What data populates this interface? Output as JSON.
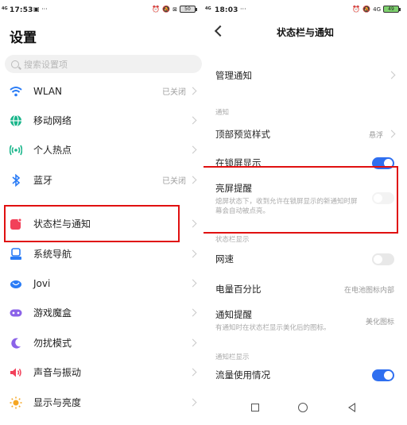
{
  "left": {
    "status": {
      "time": "17:53",
      "battery": "50"
    },
    "title": "设置",
    "search_placeholder": "搜索设置项",
    "items": [
      {
        "label": "WLAN",
        "value": "已关闭",
        "icon": "wifi-icon",
        "color": "#2a7cf6"
      },
      {
        "label": "移动网络",
        "value": "",
        "icon": "globe-icon",
        "color": "#18b58a"
      },
      {
        "label": "个人热点",
        "value": "",
        "icon": "hotspot-icon",
        "color": "#18b58a"
      },
      {
        "label": "蓝牙",
        "value": "已关闭",
        "icon": "bluetooth-icon",
        "color": "#2a7cf6"
      },
      {
        "label": "状态栏与通知",
        "value": "",
        "icon": "notification-icon",
        "color": "#f2415a"
      },
      {
        "label": "系统导航",
        "value": "",
        "icon": "navigation-icon",
        "color": "#2a7cf6"
      },
      {
        "label": "Jovi",
        "value": "",
        "icon": "jovi-icon",
        "color": "#2a7cf6"
      },
      {
        "label": "游戏魔盒",
        "value": "",
        "icon": "gamepad-icon",
        "color": "#8b63e8"
      },
      {
        "label": "勿扰模式",
        "value": "",
        "icon": "moon-icon",
        "color": "#8b63e8"
      },
      {
        "label": "声音与振动",
        "value": "",
        "icon": "speaker-icon",
        "color": "#f2415a"
      },
      {
        "label": "显示与亮度",
        "value": "",
        "icon": "sun-icon",
        "color": "#f5a623"
      }
    ]
  },
  "right": {
    "status": {
      "time": "18:03",
      "battery": "49"
    },
    "title": "状态栏与通知",
    "manage": "管理通知",
    "section_notify": "通知",
    "top_preview": {
      "label": "顶部预览样式",
      "value": "悬浮"
    },
    "lockscreen": {
      "label": "在锁屏显示",
      "on": true
    },
    "wake": {
      "label": "亮屏提醒",
      "desc": "熄屏状态下，收到允许在锁屏显示的新通知时屏幕会自动被点亮。",
      "on": false
    },
    "section_statusbar": "状态栏显示",
    "netspeed": {
      "label": "网速",
      "on": false
    },
    "battery_pct": {
      "label": "电量百分比",
      "value": "在电池图标内部"
    },
    "notify_hint": {
      "label": "通知提醒",
      "desc": "有通知时在状态栏显示美化后的图标。",
      "value": "美化图标"
    },
    "section_notifybar": "通知栏显示",
    "data_usage": {
      "label": "流量使用情况",
      "on": true
    }
  },
  "colors": {
    "highlight": "#e01010",
    "toggle_on": "#2f6ff0"
  }
}
